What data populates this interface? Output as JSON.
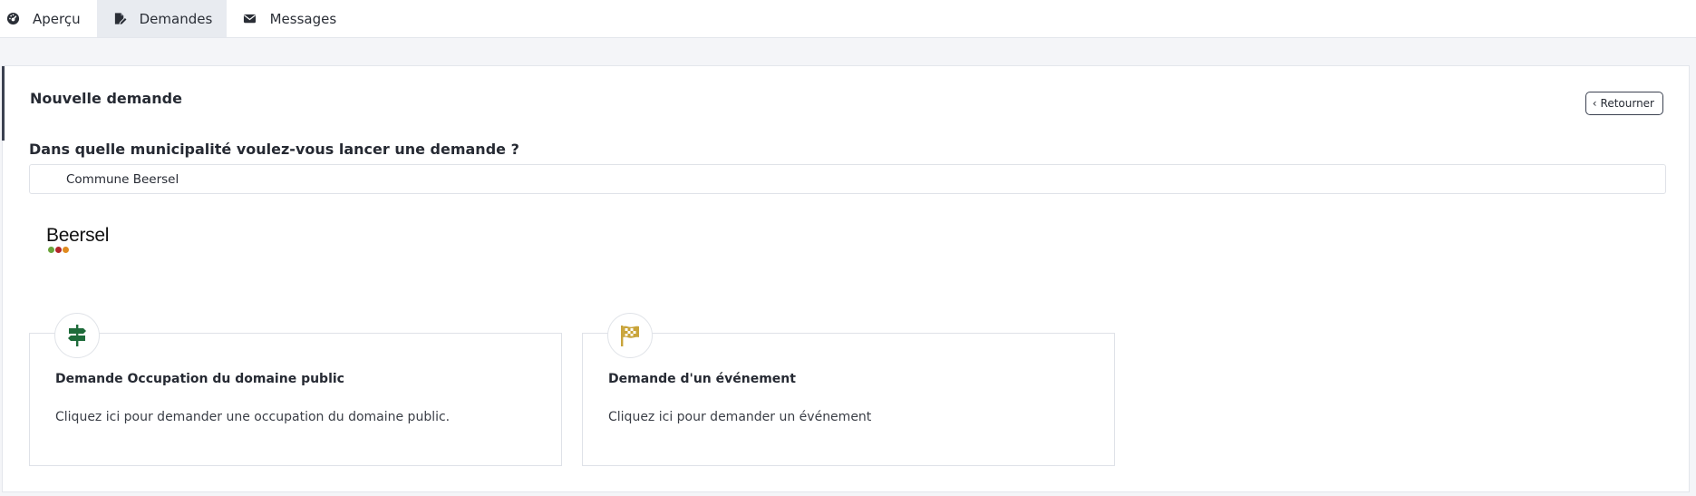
{
  "tabs": [
    {
      "label": "Aperçu",
      "icon": "dashboard-icon"
    },
    {
      "label": "Demandes",
      "icon": "edit-document-icon",
      "active": true
    },
    {
      "label": "Messages",
      "icon": "envelope-icon"
    }
  ],
  "page": {
    "title": "Nouvelle demande",
    "back_label": "Retourner",
    "question": "Dans quelle municipalité voulez-vous lancer une demande ?"
  },
  "municipality": {
    "value": "Commune Beersel",
    "logo_text": "Beersel",
    "logo_dot_colors": [
      "#6aa33a",
      "#b3262a",
      "#e08a1e"
    ]
  },
  "request_types": [
    {
      "title": "Demande Occupation du domaine public",
      "description": "Cliquez ici pour demander une occupation du domaine public.",
      "icon": "signpost-icon",
      "icon_color": "#1e6b3a"
    },
    {
      "title": "Demande d'un événement",
      "description": "Cliquez ici pour demander un événement",
      "icon": "checkered-flag-icon",
      "icon_color": "#c9a43a"
    }
  ],
  "colors": {
    "accent": "#3b4150",
    "background": "#f4f5f8",
    "active_tab": "#e8ebf0"
  }
}
